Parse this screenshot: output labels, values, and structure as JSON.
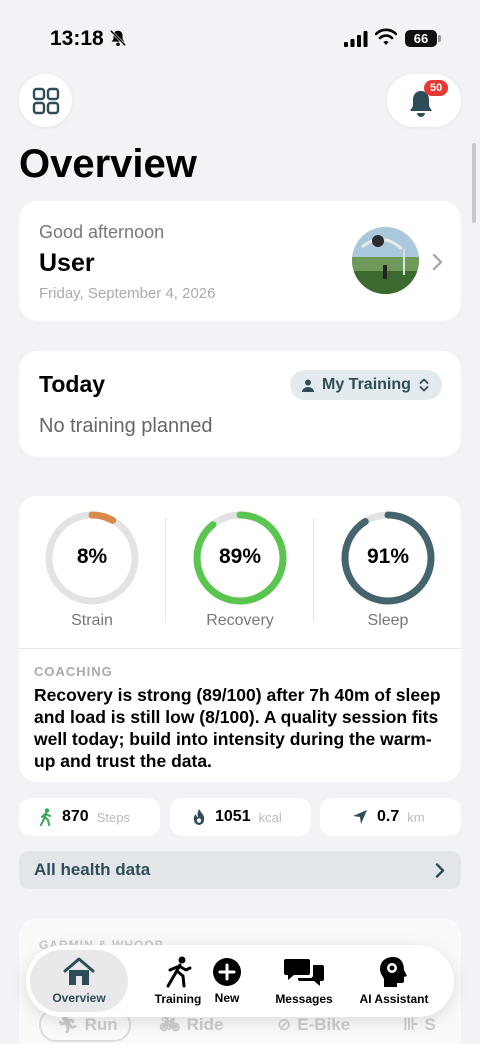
{
  "status_bar": {
    "time": "13:18",
    "battery": "66"
  },
  "header": {
    "notification_count": "50",
    "title": "Overview"
  },
  "greeting_card": {
    "greeting": "Good afternoon",
    "name": "User",
    "date": "Friday, September 4, 2026"
  },
  "today_card": {
    "title": "Today",
    "selector_label": "My Training",
    "empty_text": "No training planned"
  },
  "metrics": [
    {
      "label": "Strain",
      "value_text": "8%",
      "value": 8,
      "color": "#d88a48"
    },
    {
      "label": "Recovery",
      "value_text": "89%",
      "value": 89,
      "color": "#5ac54f"
    },
    {
      "label": "Sleep",
      "value_text": "91%",
      "value": 91,
      "color": "#46646d"
    }
  ],
  "coaching": {
    "label": "COACHING",
    "text": "Recovery is strong (89/100) after 7h 40m of sleep and load is still low (8/100). A quality session fits well today; build into intensity during the warm-up and trust the data."
  },
  "stats": [
    {
      "value": "870",
      "unit": "Steps",
      "icon": "walking-icon"
    },
    {
      "value": "1051",
      "unit": "kcal",
      "icon": "flame-icon"
    },
    {
      "value": "0.7",
      "unit": "km",
      "icon": "location-arrow-icon"
    }
  ],
  "health_link": {
    "label": "All health data"
  },
  "activity_card": {
    "label": "GARMIN & WHOOP",
    "sports": [
      "Run",
      "Ride",
      "E-Bike",
      "S"
    ]
  },
  "tabbar": {
    "tabs": [
      {
        "label": "Overview",
        "icon": "home-icon",
        "active": true
      },
      {
        "label": "Training",
        "icon": "running-icon",
        "active": false
      },
      {
        "label": "New",
        "icon": "plus-circle-icon",
        "active": false
      },
      {
        "label": "Messages",
        "icon": "chat-bubbles-icon",
        "active": false
      },
      {
        "label": "AI Assistant",
        "icon": "brain-head-icon",
        "active": false
      }
    ]
  },
  "colors": {
    "accent": "#2f4d58",
    "background": "#f2f2f7",
    "badge": "#e53935"
  }
}
